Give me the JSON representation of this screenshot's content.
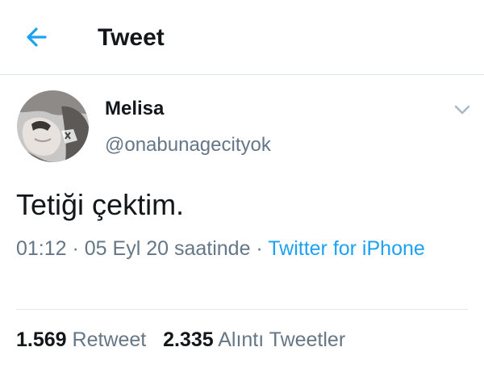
{
  "header": {
    "title": "Tweet",
    "back_icon": "arrow-left-icon"
  },
  "colors": {
    "accent": "#1da1f2",
    "text": "#14171a",
    "secondary": "#657786",
    "divider": "#e1e8ed"
  },
  "tweet": {
    "author": {
      "display_name": "Melisa",
      "handle": "@onabunagecityok"
    },
    "text": "Tetiği çektim.",
    "time": "01:12",
    "sep1": " · ",
    "date": "05 Eyl 20 saatinde",
    "sep2": " · ",
    "source": "Twitter for iPhone",
    "menu_icon": "chevron-down-icon"
  },
  "stats": {
    "retweets_count": "1.569",
    "retweets_label": "Retweet",
    "quotes_count": "2.335",
    "quotes_label": "Alıntı Tweetler"
  }
}
